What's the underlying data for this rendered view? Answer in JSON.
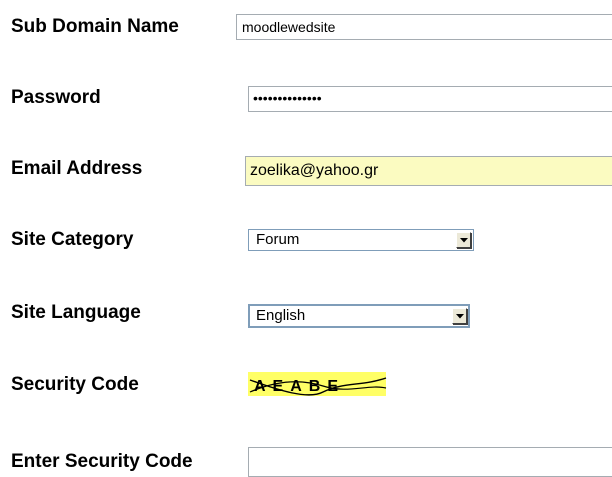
{
  "form": {
    "subdomain": {
      "label": "Sub Domain Name",
      "value": "moodlewedsite"
    },
    "password": {
      "label": "Password",
      "value": "••••••••••••••"
    },
    "email": {
      "label": "Email Address",
      "value": "zoelika@yahoo.gr"
    },
    "category": {
      "label": "Site Category",
      "value": "Forum"
    },
    "language": {
      "label": "Site Language",
      "value": "English"
    },
    "security": {
      "label": "Security Code",
      "captcha_text": "AEABE"
    },
    "enter_code": {
      "label": "Enter Security Code",
      "value": ""
    }
  },
  "colors": {
    "autofill_yellow": "#fbfbc1",
    "captcha_background": "#ffff66",
    "field_border": "#a5acb2"
  },
  "icons": {
    "dropdown": "chevron-down-icon"
  }
}
